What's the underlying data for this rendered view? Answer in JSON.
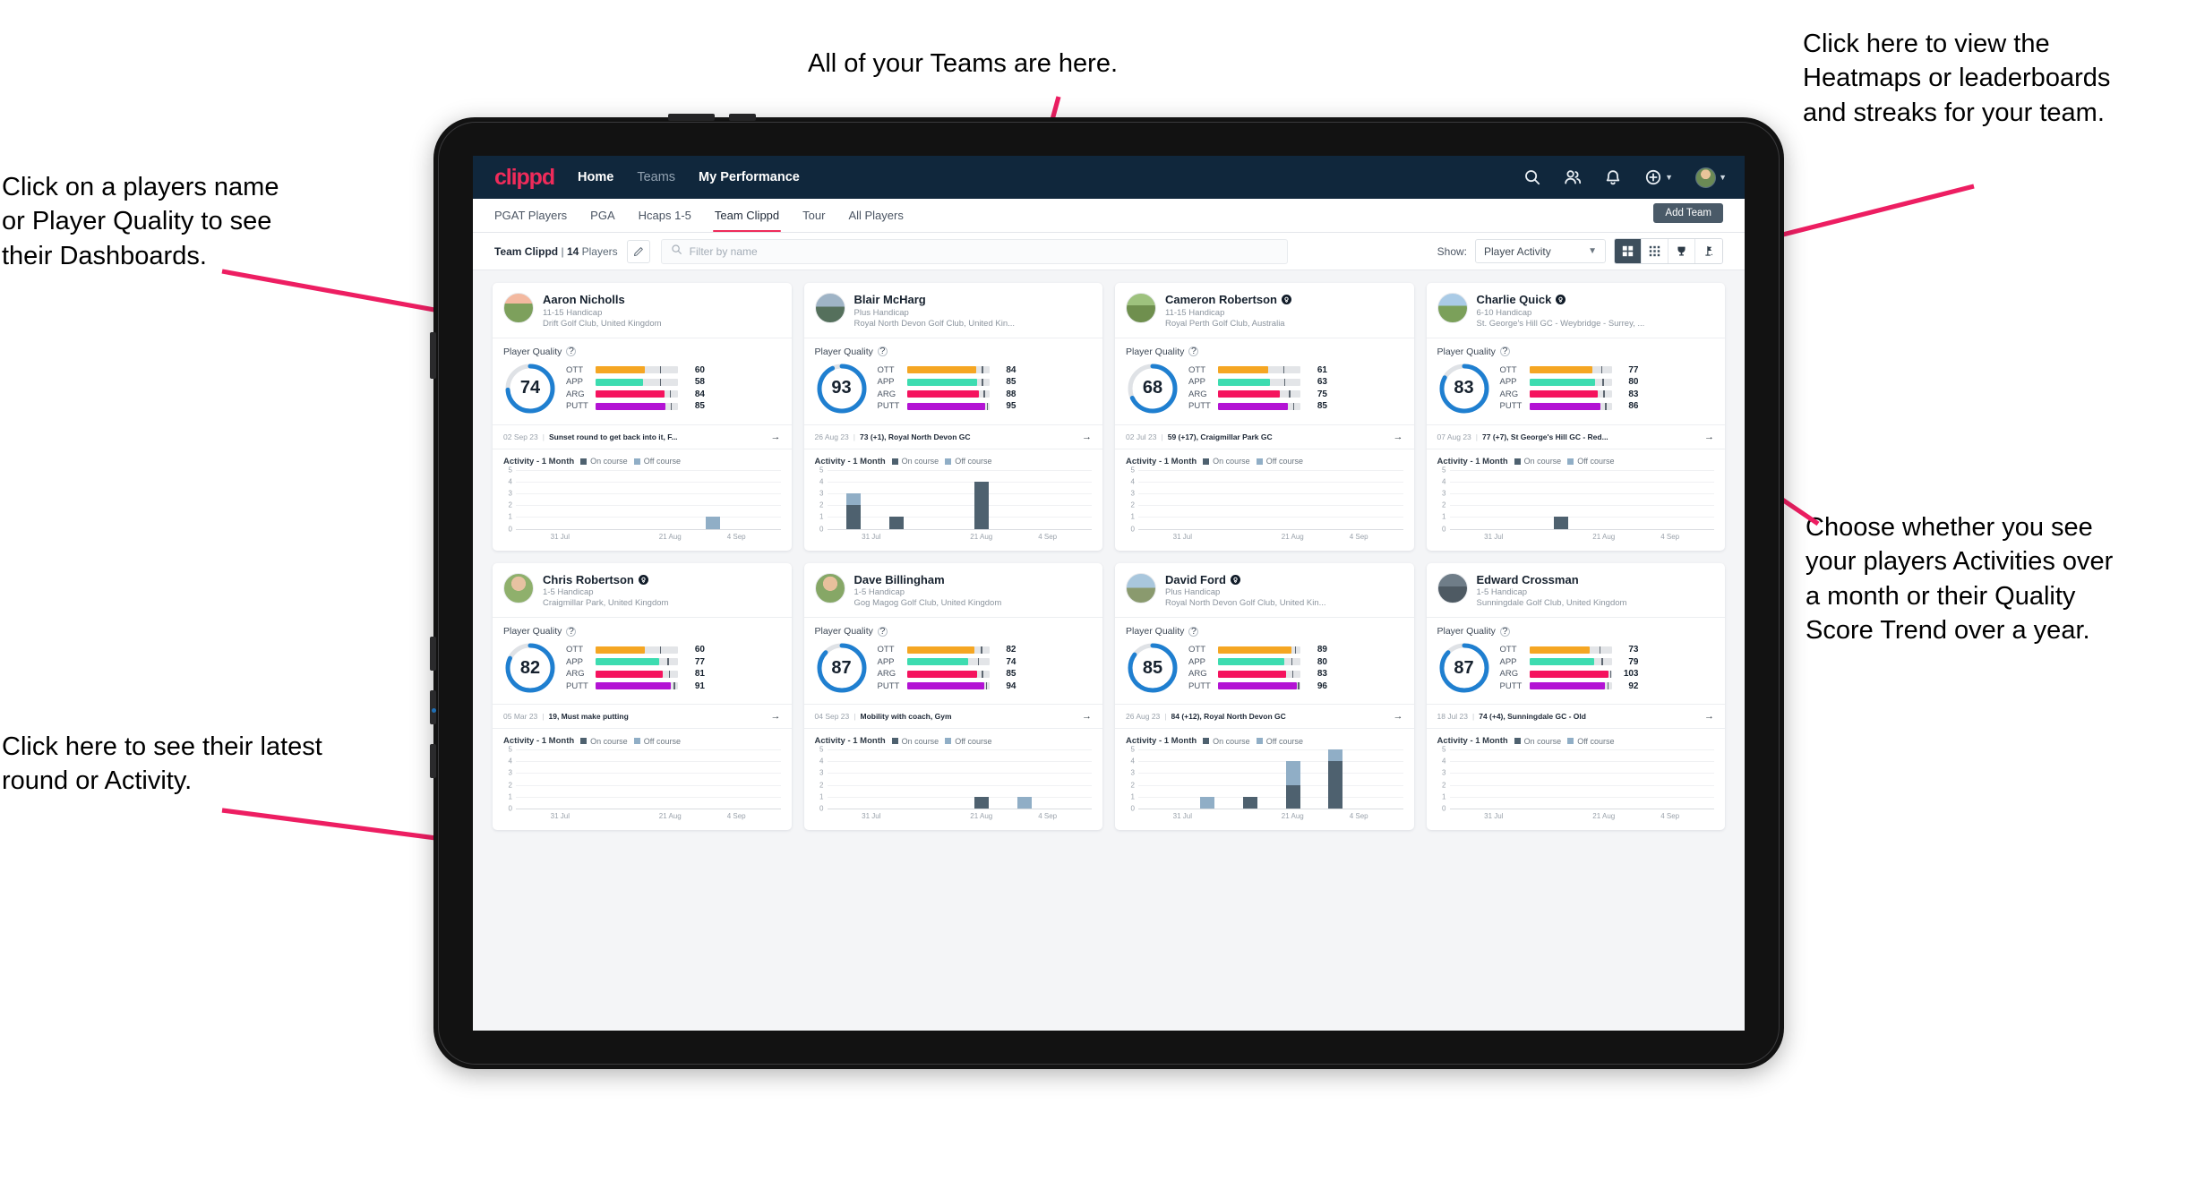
{
  "annotations": [
    {
      "id": "teams",
      "text": "All of your Teams are here."
    },
    {
      "id": "heatmaps",
      "text": "Click here to view the\nHeatmaps or leaderboards\nand streaks for your team."
    },
    {
      "id": "players",
      "text": "Click on a players name\nor Player Quality to see\ntheir Dashboards."
    },
    {
      "id": "show",
      "text": "Choose whether you see\nyour players Activities over\na month or their Quality\nScore Trend over a year."
    },
    {
      "id": "latest",
      "text": "Click here to see their latest\nround or Activity."
    }
  ],
  "app": {
    "brand": "clippd",
    "nav": [
      {
        "label": "Home",
        "active": true
      },
      {
        "label": "Teams",
        "active": false
      },
      {
        "label": "My Performance",
        "active": true
      }
    ],
    "header_icons": [
      "search-icon",
      "people-icon",
      "bell-icon",
      "plus-circle-icon",
      "avatar-icon"
    ],
    "tabs": [
      {
        "label": "PGAT Players",
        "active": false
      },
      {
        "label": "PGA",
        "active": false
      },
      {
        "label": "Hcaps 1-5",
        "active": false
      },
      {
        "label": "Team Clippd",
        "active": true
      },
      {
        "label": "Tour",
        "active": false
      },
      {
        "label": "All Players",
        "active": false
      }
    ],
    "add_team_label": "Add Team",
    "filterbar": {
      "team_name": "Team Clippd",
      "separator": "|",
      "player_count": "14",
      "players_word": "Players",
      "edit_icon": "pencil-icon",
      "search_placeholder": "Filter by name",
      "search_value": "",
      "show_label": "Show:",
      "show_selected": "Player Activity",
      "view_buttons": [
        "grid-large-icon",
        "grid-small-icon",
        "trophy-icon",
        "golf-flag-icon"
      ],
      "active_view": 0
    },
    "card_labels": {
      "player_quality": "Player Quality",
      "help_icon": "question-mark-icon",
      "activity_title": "Activity - 1 Month",
      "legend_on": "On course",
      "legend_off": "Off course",
      "arrow_icon": "arrow-right-icon"
    },
    "metric_order": [
      "OTT",
      "APP",
      "ARG",
      "PUTT"
    ],
    "metric_colors": {
      "OTT": "#f5a623",
      "APP": "#3ddcb0",
      "ARG": "#f5135e",
      "PUTT": "#b313d4"
    },
    "colors": {
      "topnav_bg": "#10273c",
      "brand": "#ef2b5a",
      "accent": "#ef2b5a",
      "ring": "#1f7fd0",
      "on_course": "#4e616f",
      "off_course": "#90aec6",
      "annotation_arrow": "#ed1e62"
    },
    "chart_axis": {
      "y_ticks": [
        "5",
        "4",
        "3",
        "2",
        "1",
        "0"
      ],
      "x_ticks": [
        "31 Jul",
        "21 Aug",
        "4 Sep"
      ],
      "ymax": 5
    }
  },
  "players": [
    {
      "name": "Aaron Nicholls",
      "verified": false,
      "handicap": "11-15 Handicap",
      "club": "Drift Golf Club, United Kingdom",
      "quality": 74,
      "metrics": [
        {
          "label": "OTT",
          "value": 60,
          "fill_pct": 60,
          "tick_pct": 78
        },
        {
          "label": "APP",
          "value": 58,
          "fill_pct": 58,
          "tick_pct": 78
        },
        {
          "label": "ARG",
          "value": 84,
          "fill_pct": 84,
          "tick_pct": 90
        },
        {
          "label": "PUTT",
          "value": 85,
          "fill_pct": 85,
          "tick_pct": 91
        }
      ],
      "round_date": "02 Sep 23",
      "round_text": "Sunset round to get back into it, F...",
      "activity": [
        {
          "on": 0,
          "off": 0
        },
        {
          "on": 0,
          "off": 0
        },
        {
          "on": 0,
          "off": 0
        },
        {
          "on": 0,
          "off": 0
        },
        {
          "on": 0,
          "off": 1
        },
        {
          "on": 0,
          "off": 0
        }
      ]
    },
    {
      "name": "Blair McHarg",
      "verified": false,
      "handicap": "Plus Handicap",
      "club": "Royal North Devon Golf Club, United Kin...",
      "quality": 93,
      "metrics": [
        {
          "label": "OTT",
          "value": 84,
          "fill_pct": 84,
          "tick_pct": 91
        },
        {
          "label": "APP",
          "value": 85,
          "fill_pct": 85,
          "tick_pct": 91
        },
        {
          "label": "ARG",
          "value": 88,
          "fill_pct": 88,
          "tick_pct": 93
        },
        {
          "label": "PUTT",
          "value": 95,
          "fill_pct": 95,
          "tick_pct": 97
        }
      ],
      "round_date": "26 Aug 23",
      "round_text": "73 (+1), Royal North Devon GC",
      "activity": [
        {
          "on": 2,
          "off": 1
        },
        {
          "on": 1,
          "off": 0
        },
        {
          "on": 0,
          "off": 0
        },
        {
          "on": 4,
          "off": 0
        },
        {
          "on": 0,
          "off": 0
        },
        {
          "on": 0,
          "off": 0
        }
      ]
    },
    {
      "name": "Cameron Robertson",
      "verified": true,
      "handicap": "11-15 Handicap",
      "club": "Royal Perth Golf Club, Australia",
      "quality": 68,
      "metrics": [
        {
          "label": "OTT",
          "value": 61,
          "fill_pct": 61,
          "tick_pct": 79
        },
        {
          "label": "APP",
          "value": 63,
          "fill_pct": 63,
          "tick_pct": 80
        },
        {
          "label": "ARG",
          "value": 75,
          "fill_pct": 75,
          "tick_pct": 86
        },
        {
          "label": "PUTT",
          "value": 85,
          "fill_pct": 85,
          "tick_pct": 91
        }
      ],
      "round_date": "02 Jul 23",
      "round_text": "59 (+17), Craigmillar Park GC",
      "activity": [
        {
          "on": 0,
          "off": 0
        },
        {
          "on": 0,
          "off": 0
        },
        {
          "on": 0,
          "off": 0
        },
        {
          "on": 0,
          "off": 0
        },
        {
          "on": 0,
          "off": 0
        },
        {
          "on": 0,
          "off": 0
        }
      ]
    },
    {
      "name": "Charlie Quick",
      "verified": true,
      "handicap": "6-10 Handicap",
      "club": "St. George's Hill GC - Weybridge - Surrey, ...",
      "quality": 83,
      "metrics": [
        {
          "label": "OTT",
          "value": 77,
          "fill_pct": 77,
          "tick_pct": 87
        },
        {
          "label": "APP",
          "value": 80,
          "fill_pct": 80,
          "tick_pct": 89
        },
        {
          "label": "ARG",
          "value": 83,
          "fill_pct": 83,
          "tick_pct": 90
        },
        {
          "label": "PUTT",
          "value": 86,
          "fill_pct": 86,
          "tick_pct": 92
        }
      ],
      "round_date": "07 Aug 23",
      "round_text": "77 (+7), St George's Hill GC - Red...",
      "activity": [
        {
          "on": 0,
          "off": 0
        },
        {
          "on": 0,
          "off": 0
        },
        {
          "on": 1,
          "off": 0
        },
        {
          "on": 0,
          "off": 0
        },
        {
          "on": 0,
          "off": 0
        },
        {
          "on": 0,
          "off": 0
        }
      ]
    },
    {
      "name": "Chris Robertson",
      "verified": true,
      "handicap": "1-5 Handicap",
      "club": "Craigmillar Park, United Kingdom",
      "quality": 82,
      "metrics": [
        {
          "label": "OTT",
          "value": 60,
          "fill_pct": 60,
          "tick_pct": 78
        },
        {
          "label": "APP",
          "value": 77,
          "fill_pct": 77,
          "tick_pct": 87
        },
        {
          "label": "ARG",
          "value": 81,
          "fill_pct": 81,
          "tick_pct": 89
        },
        {
          "label": "PUTT",
          "value": 91,
          "fill_pct": 91,
          "tick_pct": 95
        }
      ],
      "round_date": "05 Mar 23",
      "round_text": "19, Must make putting",
      "activity": [
        {
          "on": 0,
          "off": 0
        },
        {
          "on": 0,
          "off": 0
        },
        {
          "on": 0,
          "off": 0
        },
        {
          "on": 0,
          "off": 0
        },
        {
          "on": 0,
          "off": 0
        },
        {
          "on": 0,
          "off": 0
        }
      ]
    },
    {
      "name": "Dave Billingham",
      "verified": false,
      "handicap": "1-5 Handicap",
      "club": "Gog Magog Golf Club, United Kingdom",
      "quality": 87,
      "metrics": [
        {
          "label": "OTT",
          "value": 82,
          "fill_pct": 82,
          "tick_pct": 90
        },
        {
          "label": "APP",
          "value": 74,
          "fill_pct": 74,
          "tick_pct": 86
        },
        {
          "label": "ARG",
          "value": 85,
          "fill_pct": 85,
          "tick_pct": 91
        },
        {
          "label": "PUTT",
          "value": 94,
          "fill_pct": 94,
          "tick_pct": 96
        }
      ],
      "round_date": "04 Sep 23",
      "round_text": "Mobility with coach, Gym",
      "activity": [
        {
          "on": 0,
          "off": 0
        },
        {
          "on": 0,
          "off": 0
        },
        {
          "on": 0,
          "off": 0
        },
        {
          "on": 1,
          "off": 0
        },
        {
          "on": 0,
          "off": 1
        },
        {
          "on": 0,
          "off": 0
        }
      ]
    },
    {
      "name": "David Ford",
      "verified": true,
      "handicap": "Plus Handicap",
      "club": "Royal North Devon Golf Club, United Kin...",
      "quality": 85,
      "metrics": [
        {
          "label": "OTT",
          "value": 89,
          "fill_pct": 89,
          "tick_pct": 93
        },
        {
          "label": "APP",
          "value": 80,
          "fill_pct": 80,
          "tick_pct": 89
        },
        {
          "label": "ARG",
          "value": 83,
          "fill_pct": 83,
          "tick_pct": 90
        },
        {
          "label": "PUTT",
          "value": 96,
          "fill_pct": 96,
          "tick_pct": 97
        }
      ],
      "round_date": "26 Aug 23",
      "round_text": "84 (+12), Royal North Devon GC",
      "activity": [
        {
          "on": 0,
          "off": 0
        },
        {
          "on": 0,
          "off": 1
        },
        {
          "on": 1,
          "off": 0
        },
        {
          "on": 2,
          "off": 2
        },
        {
          "on": 4,
          "off": 1
        },
        {
          "on": 0,
          "off": 0
        }
      ]
    },
    {
      "name": "Edward Crossman",
      "verified": false,
      "handicap": "1-5 Handicap",
      "club": "Sunningdale Golf Club, United Kingdom",
      "quality": 87,
      "metrics": [
        {
          "label": "OTT",
          "value": 73,
          "fill_pct": 73,
          "tick_pct": 85
        },
        {
          "label": "APP",
          "value": 79,
          "fill_pct": 79,
          "tick_pct": 88
        },
        {
          "label": "ARG",
          "value": 103,
          "fill_pct": 96,
          "tick_pct": 98
        },
        {
          "label": "PUTT",
          "value": 92,
          "fill_pct": 92,
          "tick_pct": 95
        }
      ],
      "round_date": "18 Jul 23",
      "round_text": "74 (+4), Sunningdale GC - Old",
      "activity": [
        {
          "on": 0,
          "off": 0
        },
        {
          "on": 0,
          "off": 0
        },
        {
          "on": 0,
          "off": 0
        },
        {
          "on": 0,
          "off": 0
        },
        {
          "on": 0,
          "off": 0
        },
        {
          "on": 0,
          "off": 0
        }
      ]
    }
  ]
}
